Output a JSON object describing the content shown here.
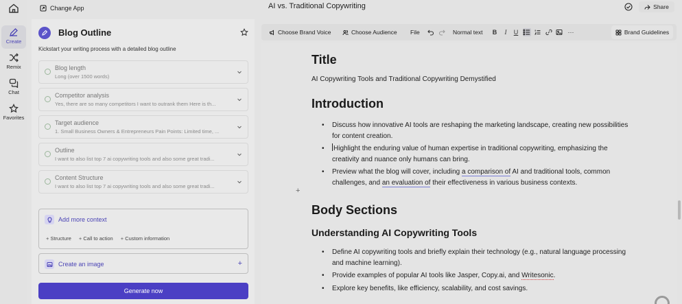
{
  "rail": {
    "items": [
      {
        "label": "Create"
      },
      {
        "label": "Remix"
      },
      {
        "label": "Chat"
      },
      {
        "label": "Favorites"
      }
    ]
  },
  "header": {
    "change_app": "Change App",
    "doc_title": "AI vs. Traditional Copywriting",
    "share": "Share"
  },
  "panel": {
    "title": "Blog Outline",
    "subtitle": "Kickstart your writing process with a detailed blog outline",
    "fields": [
      {
        "title": "Blog length",
        "value": "Long (over 1500 words)"
      },
      {
        "title": "Competitor analysis",
        "value": "Yes, there are so many competitors I want to outrank them Here is th..."
      },
      {
        "title": "Target audience",
        "value": "1. Small Business Owners & Entrepreneurs Pain Points: Limited time, ..."
      },
      {
        "title": "Outline",
        "value": "I want to also list top 7 ai copywriting tools and also some great tradi..."
      },
      {
        "title": "Content Structure",
        "value": "I want to also list top 7 ai copywriting tools and also some great tradi..."
      }
    ],
    "context": {
      "title": "Add more context",
      "options": [
        "Structure",
        "Call to action",
        "Custom information"
      ]
    },
    "image": {
      "title": "Create an image",
      "plus": "+"
    },
    "generate": "Generate now"
  },
  "toolbar": {
    "brand_voice": "Choose Brand Voice",
    "audience": "Choose Audience",
    "file": "File",
    "style": "Normal text",
    "bold": "B",
    "italic": "I",
    "underline": "U",
    "more": "···",
    "brand_guidelines": "Brand Guidelines"
  },
  "editor": {
    "title_heading": "Title",
    "title_text": "AI Copywriting Tools and Traditional Copywriting Demystified",
    "intro_heading": "Introduction",
    "intro_bullets": {
      "b1": "Discuss how innovative AI tools are reshaping the marketing landscape, creating new possibilities for content creation.",
      "b2": "Highlight the enduring value of human expertise in traditional copywriting, emphasizing the creativity and nuance only humans can bring.",
      "b3_a": "Preview what the blog will cover, including ",
      "b3_link1": "a comparison of",
      "b3_b": " AI and traditional tools, common challenges, and ",
      "b3_link2": "an evaluation of",
      "b3_c": " their effectiveness in various business contexts."
    },
    "plus": "+",
    "body_heading": "Body Sections",
    "understanding_heading": "Understanding AI Copywriting Tools",
    "body_bullets": {
      "b1": "Define AI copywriting tools and briefly explain their technology (e.g., natural language processing and machine learning).",
      "b2_a": "Provide examples of popular AI tools like Jasper, Copy.ai, and ",
      "b2_red": "Writesonic",
      "b2_b": ".",
      "b3": "Explore key benefits, like efficiency, scalability, and cost savings."
    }
  },
  "colors": {
    "accent": "#4b3fc4",
    "accent_text": "#4b44b5",
    "panel_bg": "#e9e9e9",
    "editor_bg": "#e4e4e4"
  }
}
